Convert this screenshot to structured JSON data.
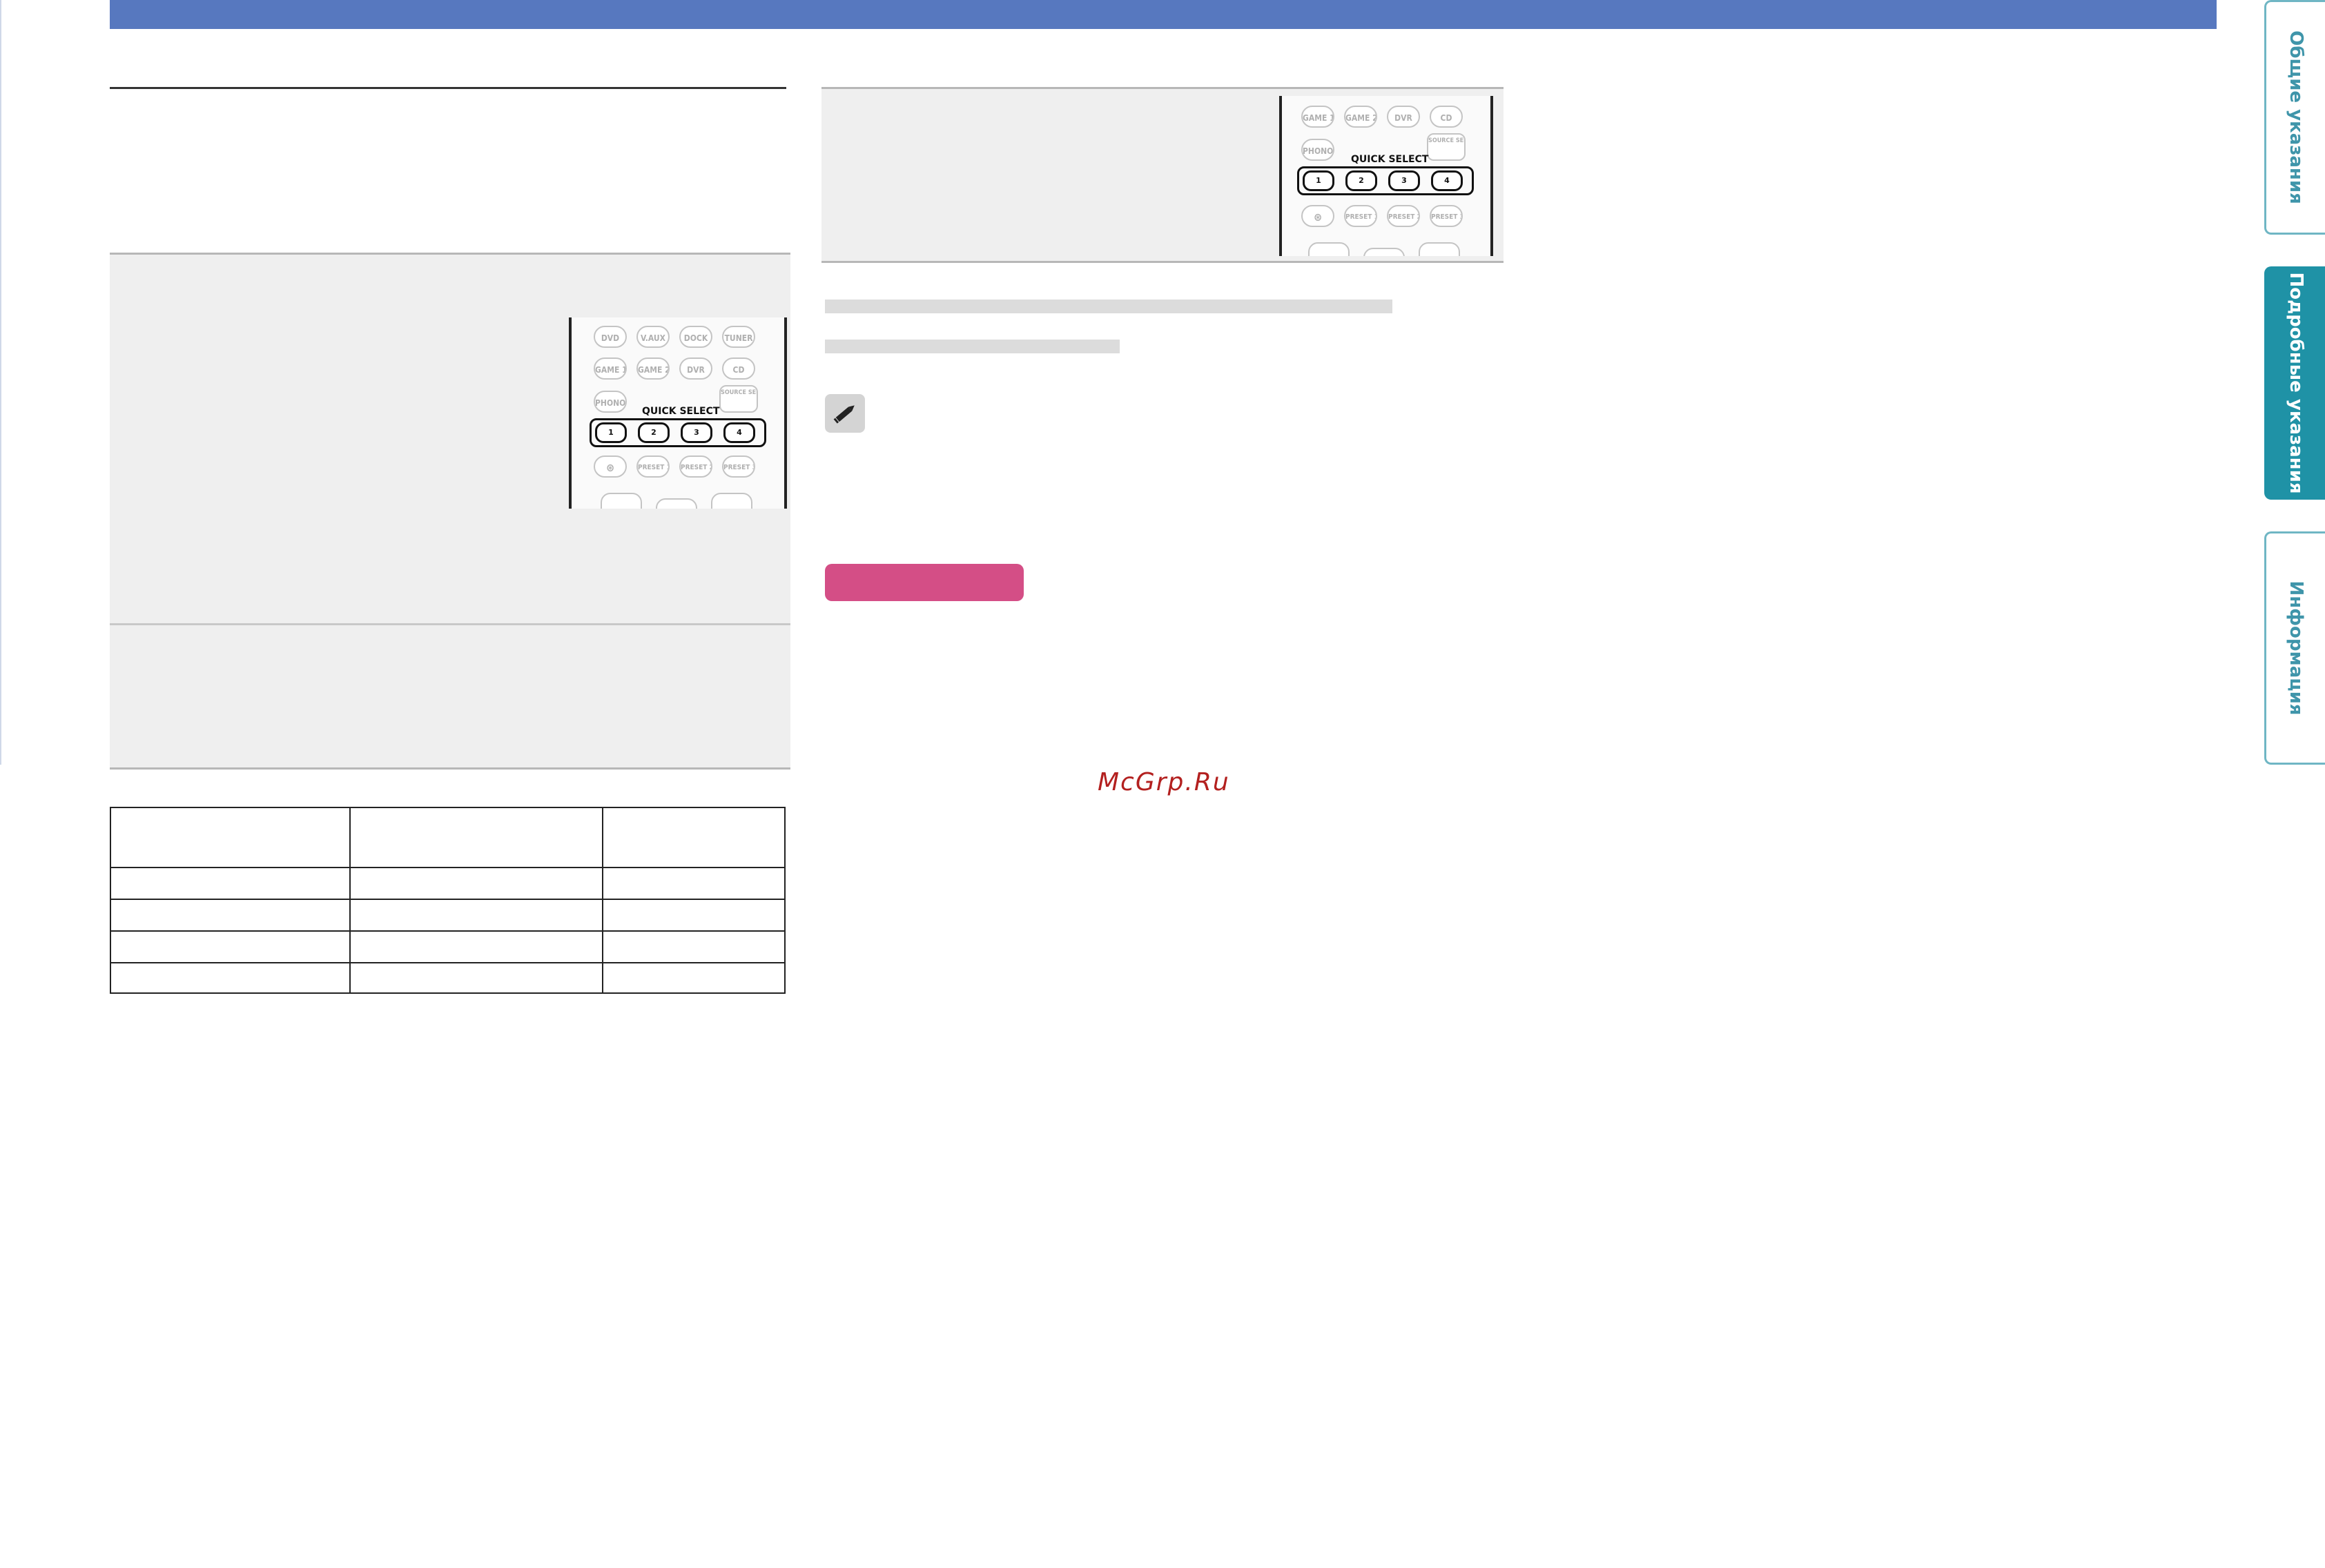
{
  "side_tabs": {
    "general": "Общие указания",
    "detailed": "Подробные указания",
    "info": "Информация"
  },
  "remote_left": {
    "row1": [
      "DVD",
      "V.AUX",
      "DOCK",
      "TUNER"
    ],
    "row2": [
      "GAME 1",
      "GAME 2",
      "DVR",
      "CD"
    ],
    "row3_left": "PHONO",
    "row3_right": "SOURCE SELECT",
    "quick_select_label": "QUICK SELECT",
    "quick_buttons": [
      "1",
      "2",
      "3",
      "4"
    ],
    "row5": [
      "PRESET 1",
      "PRESET 2",
      "PRESET 3"
    ]
  },
  "remote_right": {
    "row1": [
      "GAME 1",
      "GAME 2",
      "DVR",
      "CD"
    ],
    "row2_left": "PHONO",
    "row2_right": "SOURCE SELECT",
    "quick_select_label": "QUICK SELECT",
    "quick_buttons": [
      "1",
      "2",
      "3",
      "4"
    ],
    "row4": [
      "PRESET 1",
      "PRESET 2",
      "PRESET 3"
    ]
  },
  "note_icon": "pencil-icon",
  "colors": {
    "top_bar": "#5778bf",
    "tab_active": "#1f92a6",
    "tab_border": "#6fb6c4",
    "badge": "#d44e86",
    "watermark": "#b3201f"
  },
  "watermark": "McGrp.Ru"
}
